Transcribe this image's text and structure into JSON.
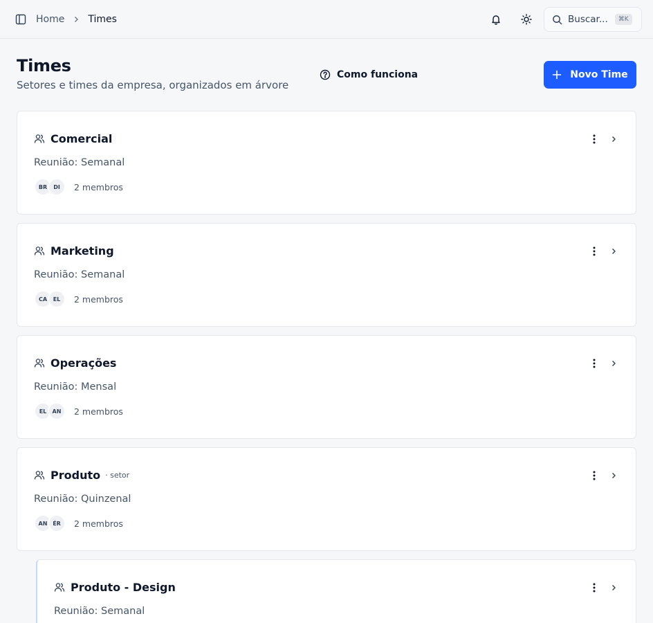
{
  "breadcrumb": {
    "home": "Home",
    "current": "Times"
  },
  "search": {
    "label": "Buscar...",
    "shortcut": "⌘K"
  },
  "header": {
    "title": "Times",
    "subtitle": "Setores e times da empresa, organizados em árvore",
    "how_it_works": "Como funciona",
    "new_team": "Novo Time"
  },
  "colors": {
    "primary": "#1d5cff",
    "child_indent_line": "#bfdbfe"
  },
  "teams": [
    {
      "name": "Comercial",
      "tag": "",
      "meeting": "Reunião: Semanal",
      "avatars": [
        "BR",
        "DI"
      ],
      "members": "2 membros"
    },
    {
      "name": "Marketing",
      "tag": "",
      "meeting": "Reunião: Semanal",
      "avatars": [
        "CA",
        "EL"
      ],
      "members": "2 membros"
    },
    {
      "name": "Operações",
      "tag": "",
      "meeting": "Reunião: Mensal",
      "avatars": [
        "EL",
        "AN"
      ],
      "members": "2 membros"
    },
    {
      "name": "Produto",
      "tag": "· setor",
      "meeting": "Reunião: Quinzenal",
      "avatars": [
        "AN",
        "ÉR"
      ],
      "members": "2 membros"
    },
    {
      "name": "Produto - Design",
      "tag": "",
      "meeting": "Reunião: Semanal",
      "avatars": [],
      "members": ""
    }
  ]
}
